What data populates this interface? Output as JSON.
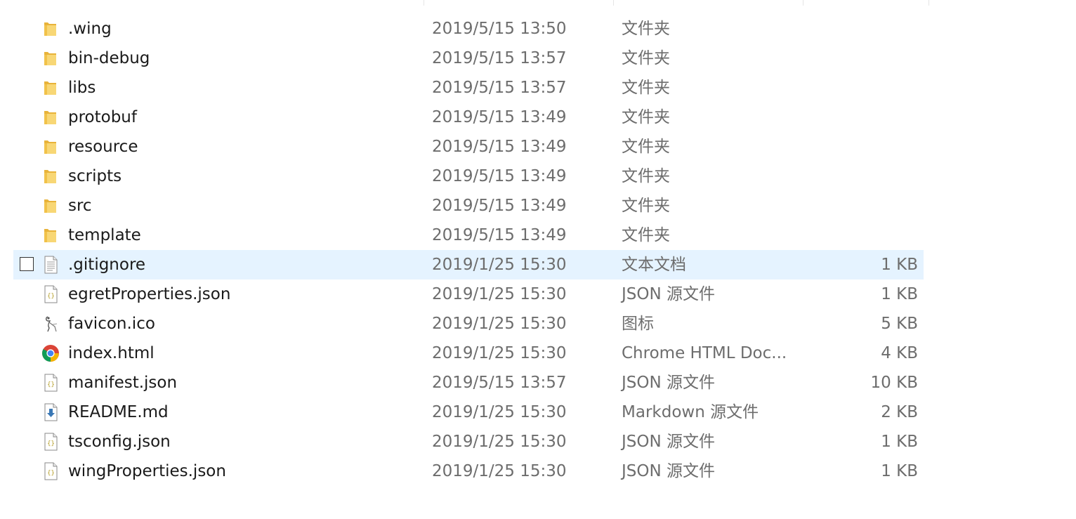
{
  "files": [
    {
      "name": ".wing",
      "date": "2019/5/15 13:50",
      "type": "文件夹",
      "size": "",
      "icon": "folder-icon"
    },
    {
      "name": "bin-debug",
      "date": "2019/5/15 13:57",
      "type": "文件夹",
      "size": "",
      "icon": "folder-icon"
    },
    {
      "name": "libs",
      "date": "2019/5/15 13:57",
      "type": "文件夹",
      "size": "",
      "icon": "folder-icon"
    },
    {
      "name": "protobuf",
      "date": "2019/5/15 13:49",
      "type": "文件夹",
      "size": "",
      "icon": "folder-icon"
    },
    {
      "name": "resource",
      "date": "2019/5/15 13:49",
      "type": "文件夹",
      "size": "",
      "icon": "folder-icon"
    },
    {
      "name": "scripts",
      "date": "2019/5/15 13:49",
      "type": "文件夹",
      "size": "",
      "icon": "folder-icon"
    },
    {
      "name": "src",
      "date": "2019/5/15 13:49",
      "type": "文件夹",
      "size": "",
      "icon": "folder-icon"
    },
    {
      "name": "template",
      "date": "2019/5/15 13:49",
      "type": "文件夹",
      "size": "",
      "icon": "folder-icon"
    },
    {
      "name": ".gitignore",
      "date": "2019/1/25 15:30",
      "type": "文本文档",
      "size": "1 KB",
      "icon": "text-document-icon"
    },
    {
      "name": "egretProperties.json",
      "date": "2019/1/25 15:30",
      "type": "JSON 源文件",
      "size": "1 KB",
      "icon": "json-file-icon"
    },
    {
      "name": "favicon.ico",
      "date": "2019/1/25 15:30",
      "type": "图标",
      "size": "5 KB",
      "icon": "ico-file-icon"
    },
    {
      "name": "index.html",
      "date": "2019/1/25 15:30",
      "type": "Chrome HTML Doc...",
      "size": "4 KB",
      "icon": "chrome-icon"
    },
    {
      "name": "manifest.json",
      "date": "2019/5/15 13:57",
      "type": "JSON 源文件",
      "size": "10 KB",
      "icon": "json-file-icon"
    },
    {
      "name": "README.md",
      "date": "2019/1/25 15:30",
      "type": "Markdown 源文件",
      "size": "2 KB",
      "icon": "markdown-file-icon"
    },
    {
      "name": "tsconfig.json",
      "date": "2019/1/25 15:30",
      "type": "JSON 源文件",
      "size": "1 KB",
      "icon": "json-file-icon"
    },
    {
      "name": "wingProperties.json",
      "date": "2019/1/25 15:30",
      "type": "JSON 源文件",
      "size": "1 KB",
      "icon": "json-file-icon"
    }
  ],
  "selected_index": 8,
  "colors": {
    "selection": "#e5f3ff",
    "folder": "#f4c84b",
    "name_text": "#1a1a1a",
    "meta_text": "#6d6d6d"
  }
}
